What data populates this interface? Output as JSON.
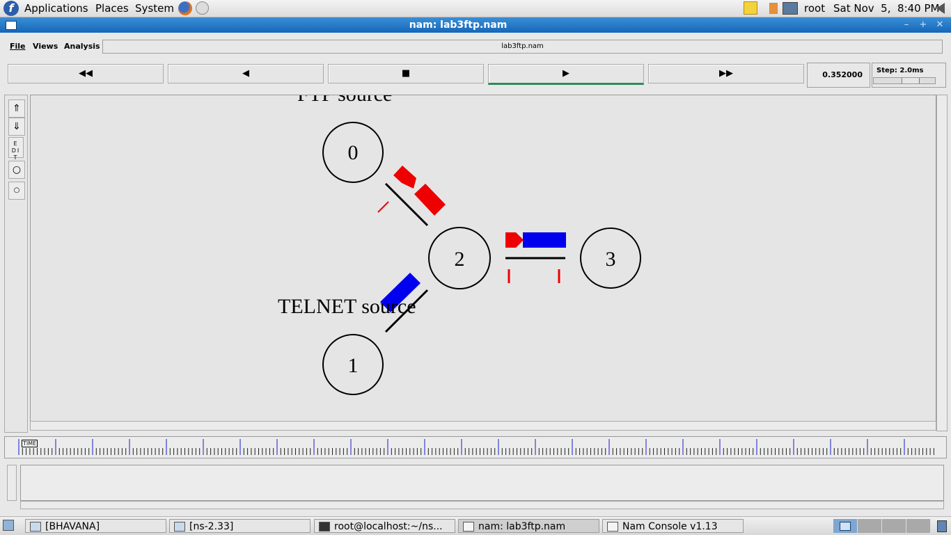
{
  "top_panel": {
    "menus": [
      "Applications",
      "Places",
      "System"
    ],
    "user": "root",
    "clock": "Sat Nov  5,  8:40 PM"
  },
  "window": {
    "title": "nam: lab3ftp.nam",
    "menu": [
      "File",
      "Views",
      "Analysis"
    ],
    "file_field": "lab3ftp.nam"
  },
  "controls": {
    "time": "0.352000",
    "step_label": "Step: 2.0ms",
    "buttons": [
      "◀◀",
      "◀",
      "■",
      "▶",
      "▶▶"
    ]
  },
  "tools": [
    "EDIT"
  ],
  "network": {
    "nodes": [
      "0",
      "1",
      "2",
      "3"
    ],
    "labels": [
      "FTP source",
      "TELNET source"
    ],
    "colors": {
      "ftp": "#ee0000",
      "telnet": "#0000ee"
    }
  },
  "timeline": {
    "tag": "TIME"
  },
  "taskbar": {
    "tasks": [
      "[BHAVANA]",
      "[ns-2.33]",
      "root@localhost:~/ns...",
      "nam: lab3ftp.nam",
      "Nam Console v1.13"
    ]
  }
}
